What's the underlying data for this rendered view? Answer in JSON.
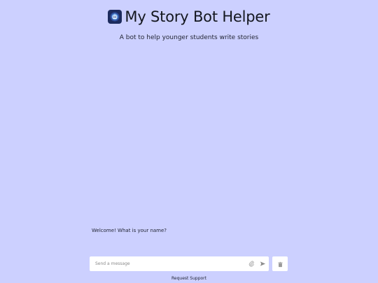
{
  "header": {
    "title": "My Story Bot Helper",
    "logo_icon": "robot-logo-icon",
    "subtitle": "A bot to help younger students write stories"
  },
  "chat": {
    "messages": [
      {
        "sender": "bot",
        "text": "Welcome! What is your name?"
      }
    ]
  },
  "composer": {
    "placeholder": "Send a message",
    "value": "",
    "attach_icon": "paperclip-icon",
    "send_icon": "send-icon"
  },
  "actions": {
    "clear_icon": "trash-icon"
  },
  "footer": {
    "support_label": "Request Support"
  },
  "colors": {
    "background": "#ccd0ff",
    "input_background": "#ffffff",
    "logo_background": "#1d2b5e"
  }
}
